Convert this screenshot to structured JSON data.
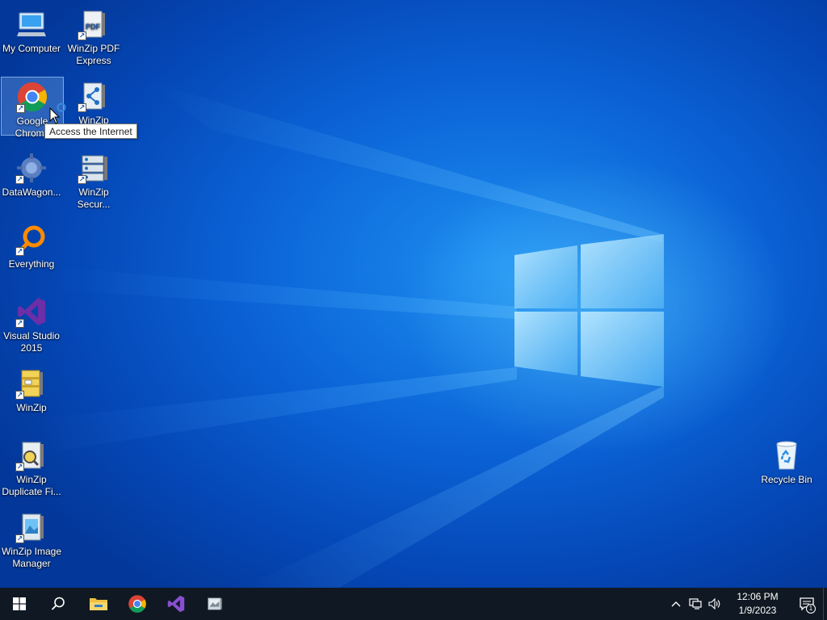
{
  "desktop": {
    "icons_left": [
      {
        "label": "My Computer",
        "icon": "computer-icon"
      },
      {
        "label": "Google Chrome",
        "icon": "chrome-icon",
        "selected": true
      },
      {
        "label": "DataWagon...",
        "icon": "datawagon-icon"
      },
      {
        "label": "Everything",
        "icon": "everything-icon"
      },
      {
        "label": "Visual Studio 2015",
        "icon": "visual-studio-icon"
      },
      {
        "label": "WinZip",
        "icon": "winzip-icon"
      },
      {
        "label": "WinZip Duplicate Fi...",
        "icon": "winzip-duplicate-icon"
      },
      {
        "label": "WinZip Image Manager",
        "icon": "winzip-image-icon"
      }
    ],
    "icons_right": [
      {
        "label": "WinZip PDF Express",
        "icon": "pdf-icon"
      },
      {
        "label": "WinZip",
        "icon": "winzip-share-icon"
      },
      {
        "label": "WinZip Secur...",
        "icon": "winzip-secure-icon"
      }
    ],
    "recycle_bin": {
      "label": "Recycle Bin",
      "icon": "recycle-bin-icon"
    },
    "tooltip": "Access the Internet",
    "colors": {
      "wallpaper": "#0b63d6",
      "logo_glow": "#9fe0ff"
    }
  },
  "taskbar": {
    "pinned": [
      {
        "name": "start-button",
        "icon": "windows-logo-icon"
      },
      {
        "name": "search-button",
        "icon": "search-icon"
      },
      {
        "name": "file-explorer",
        "icon": "folder-icon"
      },
      {
        "name": "chrome",
        "icon": "chrome-icon"
      },
      {
        "name": "visual-studio",
        "icon": "visual-studio-icon"
      },
      {
        "name": "winzip-image-manager",
        "icon": "winzip-image-icon"
      }
    ],
    "clock": {
      "time": "12:06 PM",
      "date": "1/9/2023"
    },
    "notification_count": "1",
    "colors": {
      "taskbar": "#101923"
    }
  }
}
